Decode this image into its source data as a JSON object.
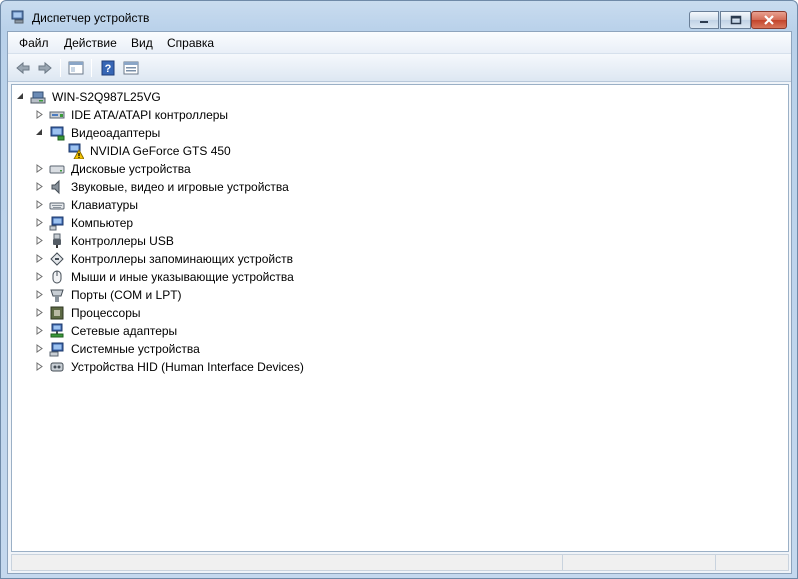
{
  "window": {
    "title": "Диспетчер устройств"
  },
  "menu": [
    "Файл",
    "Действие",
    "Вид",
    "Справка"
  ],
  "toolbar": {
    "buttons": [
      "back-icon",
      "forward-icon",
      "show-hide-console-tree-icon",
      "help-icon",
      "properties-icon"
    ]
  },
  "tree": {
    "root": "WIN-S2Q987L25VG",
    "nodes": [
      {
        "label": "IDE ATA/ATAPI контроллеры",
        "icon": "ide-controller-icon",
        "expanded": false
      },
      {
        "label": "Видеоадаптеры",
        "icon": "display-adapter-icon",
        "expanded": true
      },
      {
        "label": "NVIDIA GeForce GTS 450",
        "icon": "warning-display-icon",
        "child": true
      },
      {
        "label": "Дисковые устройства",
        "icon": "disk-drive-icon",
        "expanded": false
      },
      {
        "label": "Звуковые, видео и игровые устройства",
        "icon": "speaker-icon",
        "expanded": false
      },
      {
        "label": "Клавиатуры",
        "icon": "keyboard-icon",
        "expanded": false
      },
      {
        "label": "Компьютер",
        "icon": "computer-icon",
        "expanded": false
      },
      {
        "label": "Контроллеры USB",
        "icon": "usb-icon",
        "expanded": false
      },
      {
        "label": "Контроллеры запоминающих устройств",
        "icon": "storage-controller-icon",
        "expanded": false
      },
      {
        "label": "Мыши и иные указывающие устройства",
        "icon": "mouse-icon",
        "expanded": false
      },
      {
        "label": "Порты (COM и LPT)",
        "icon": "port-icon",
        "expanded": false
      },
      {
        "label": "Процессоры",
        "icon": "processor-icon",
        "expanded": false
      },
      {
        "label": "Сетевые адаптеры",
        "icon": "network-adapter-icon",
        "expanded": false
      },
      {
        "label": "Системные устройства",
        "icon": "system-device-icon",
        "expanded": false
      },
      {
        "label": "Устройства HID (Human Interface Devices)",
        "icon": "hid-icon",
        "expanded": false
      }
    ]
  },
  "colors": {
    "warning": "#f5c400",
    "titlebar": "#b9d1ea",
    "close": "#c2442b"
  }
}
